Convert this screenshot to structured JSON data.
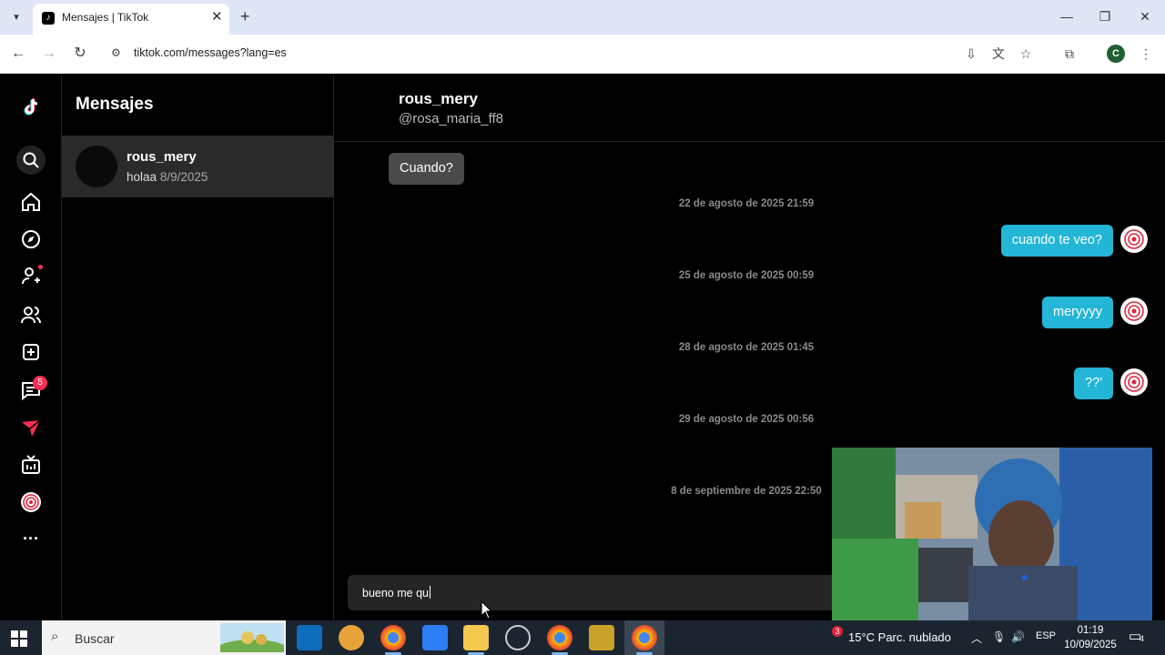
{
  "browser": {
    "tab_title": "Mensajes | TikTok",
    "tab_close": "✕",
    "new_tab": "+",
    "url": "tiktok.com/messages?lang=es",
    "profile_initial": "C",
    "window_controls": [
      "—",
      "❐",
      "✕"
    ]
  },
  "nav": {
    "icons": [
      "tiktok-logo-icon",
      "search-icon",
      "home-icon",
      "explore-icon",
      "following-icon",
      "friends-icon",
      "upload-icon",
      "messages-icon",
      "activity-icon",
      "live-icon",
      "profile-icon",
      "more-icon"
    ],
    "messages_badge": "5",
    "more": "···"
  },
  "conversations": {
    "title": "Mensajes",
    "items": [
      {
        "name": "rous_mery",
        "preview": "holaa",
        "date": "8/9/2025"
      }
    ]
  },
  "chat": {
    "name": "rous_mery",
    "handle": "@rosa_maria_ff8",
    "incoming": "Cuando?",
    "timestamps": [
      "22 de agosto de 2025 21:59",
      "25 de agosto de 2025 00:59",
      "28 de agosto de 2025 01:45",
      "29 de agosto de 2025 00:56",
      "8 de septiembre de 2025 22:50"
    ],
    "outgoing": [
      "cuando te veo?",
      "meryyyy",
      "??'"
    ],
    "composer_text": "bueno me qu"
  },
  "taskbar": {
    "search_placeholder": "Buscar",
    "weather": "15°C  Parc. nublado",
    "language": "ESP",
    "time": "01:19",
    "date": "10/09/2025",
    "notification_count": "4",
    "weather_badge": "3"
  },
  "colors": {
    "outgoing_bubble": "#23b6d6",
    "incoming_bubble": "#4a4a4a",
    "badge": "#fe2c55"
  }
}
